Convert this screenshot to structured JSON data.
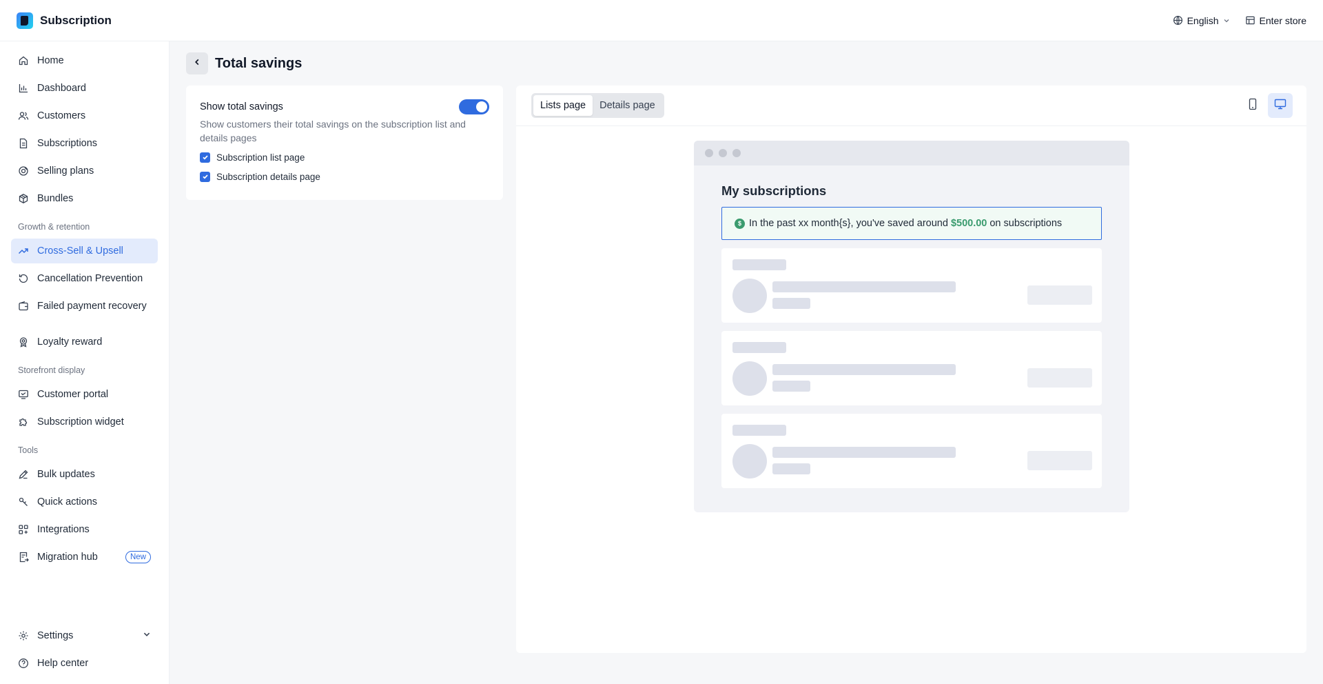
{
  "app": {
    "title": "Subscription"
  },
  "topbar": {
    "language": "English",
    "enter_store": "Enter store"
  },
  "sidebar": {
    "main_items": [
      {
        "label": "Home",
        "icon": "home-icon"
      },
      {
        "label": "Dashboard",
        "icon": "chart-icon"
      },
      {
        "label": "Customers",
        "icon": "users-icon"
      },
      {
        "label": "Subscriptions",
        "icon": "document-icon"
      },
      {
        "label": "Selling plans",
        "icon": "tag-icon"
      },
      {
        "label": "Bundles",
        "icon": "box-icon"
      }
    ],
    "growth_section": "Growth & retention",
    "growth_items": [
      {
        "label": "Cross-Sell & Upsell",
        "icon": "trend-up-icon",
        "active": true
      },
      {
        "label": "Cancellation Prevention",
        "icon": "refresh-icon"
      },
      {
        "label": "Failed payment recovery",
        "icon": "wallet-icon"
      },
      {
        "label": "Loyalty reward",
        "icon": "award-icon"
      }
    ],
    "storefront_section": "Storefront display",
    "storefront_items": [
      {
        "label": "Customer portal",
        "icon": "portal-icon"
      },
      {
        "label": "Subscription widget",
        "icon": "puzzle-icon"
      }
    ],
    "tools_section": "Tools",
    "tools_items": [
      {
        "label": "Bulk updates",
        "icon": "pencil-icon"
      },
      {
        "label": "Quick actions",
        "icon": "lightning-icon"
      },
      {
        "label": "Integrations",
        "icon": "grid-icon"
      },
      {
        "label": "Migration hub",
        "icon": "migrate-icon",
        "badge": "New"
      }
    ],
    "settings": "Settings",
    "help": "Help center"
  },
  "page": {
    "title": "Total savings"
  },
  "settings_card": {
    "toggle_label": "Show total savings",
    "toggle_on": true,
    "description": "Show customers their total savings on the subscription list and details pages",
    "checkbox_list": "Subscription list page",
    "checkbox_details": "Subscription details page"
  },
  "preview": {
    "tabs": [
      "Lists page",
      "Details page"
    ],
    "selected_tab": "Lists page",
    "device": "desktop",
    "heading": "My subscriptions",
    "banner_prefix": "In the past xx month{s}, you've saved around",
    "banner_amount": "$500.00",
    "banner_suffix": "on subscriptions"
  },
  "colors": {
    "accent": "#2f6bdf",
    "active_bg": "#e3ebfc",
    "savings_green": "#3a9b6e",
    "banner_bg": "#f1faf5"
  }
}
